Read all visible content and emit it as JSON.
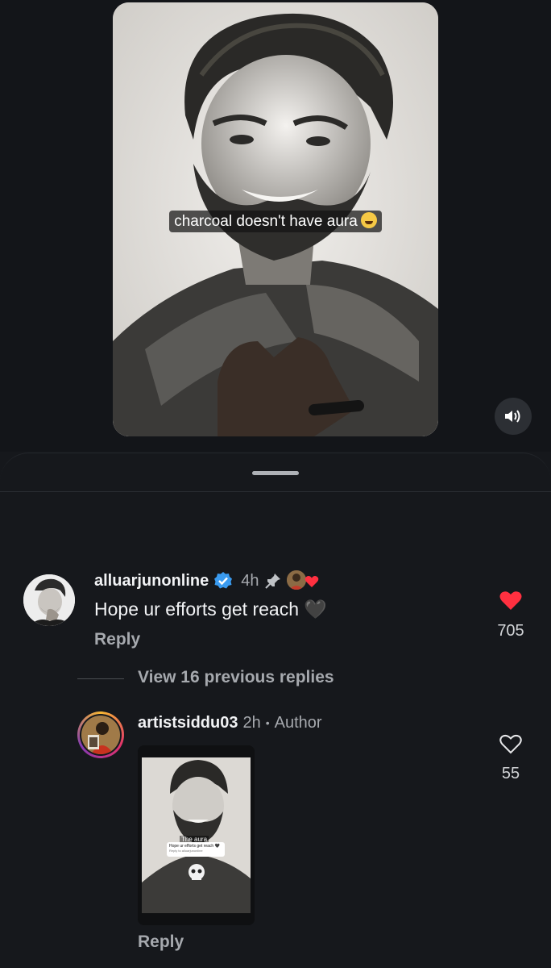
{
  "video": {
    "caption": "charcoal doesn't have aura",
    "caption_emoji": "grinning-sweat-emoji",
    "mute_icon": "speaker-on-icon"
  },
  "comment": {
    "username": "alluarjunonline",
    "verified_icon": "verified-badge-icon",
    "time": "4h",
    "pin_icon": "pin-icon",
    "creator_like_icon": "creator-heart-icon",
    "text": "Hope ur efforts get reach 🖤",
    "reply_label": "Reply",
    "liked": true,
    "like_icon": "heart-filled-icon",
    "like_count": "705",
    "like_color": "#ff3040"
  },
  "view_replies_label": "View 16 previous replies",
  "reply": {
    "username": "artistsiddu03",
    "time": "2h",
    "separator": "•",
    "author_label": "Author",
    "reply_label": "Reply",
    "liked": false,
    "like_icon": "heart-outline-icon",
    "like_count": "55",
    "thumb_caption": "The aura",
    "thumb_sticker_text": "Hope ur efforts get reach 🖤",
    "thumb_sticker_sub": "Reply to alluarjunonline",
    "avatar_ring": [
      "#f7b733",
      "#e1306c",
      "#833ab4"
    ]
  }
}
